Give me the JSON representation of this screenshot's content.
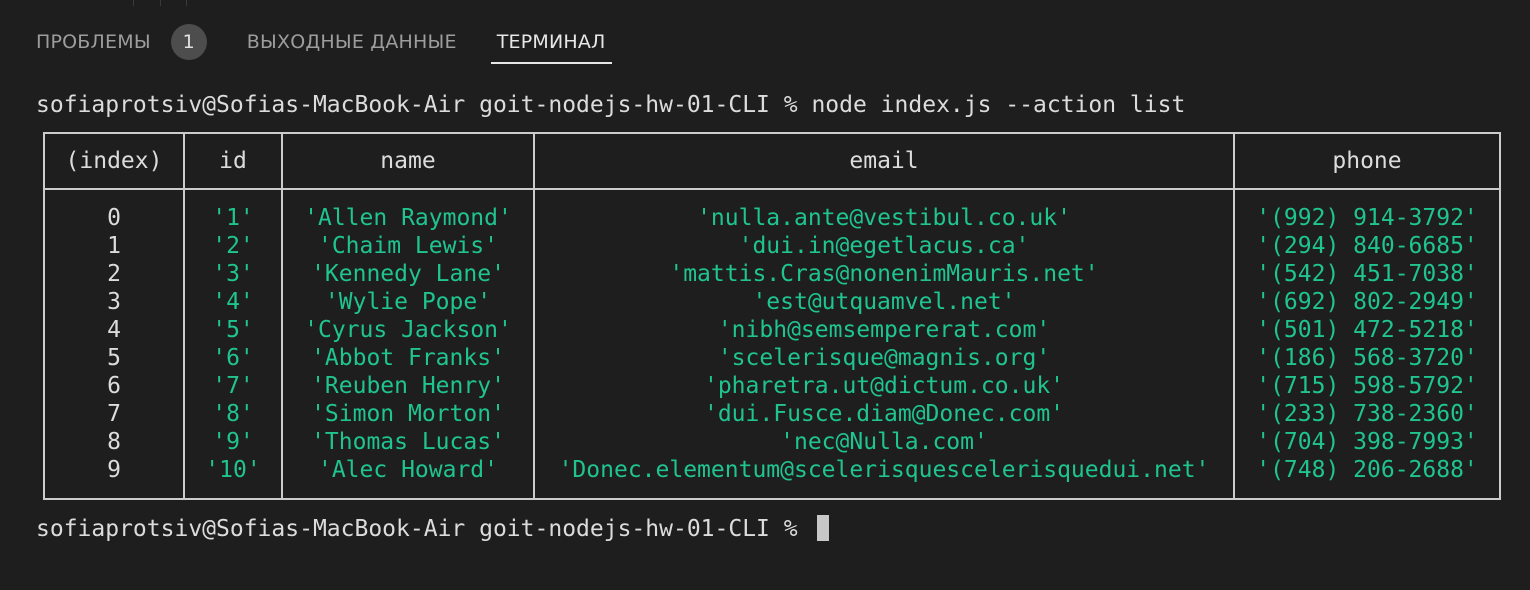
{
  "panel": {
    "tabs": [
      {
        "label": "ПРОБЛЕМЫ",
        "badge": "1"
      },
      {
        "label": "ВЫХОДНЫЕ ДАННЫЕ"
      },
      {
        "label": "ТЕРМИНАЛ",
        "active": true
      }
    ]
  },
  "terminal": {
    "command_line": "sofiaprotsiv@Sofias-MacBook-Air goit-nodejs-hw-01-CLI % node index.js --action list",
    "prompt_line": "sofiaprotsiv@Sofias-MacBook-Air goit-nodejs-hw-01-CLI % ",
    "table": {
      "headers": [
        "(index)",
        "id",
        "name",
        "email",
        "phone"
      ],
      "rows": [
        {
          "index": "0",
          "id": "'1'",
          "name": "'Allen Raymond'",
          "email": "'nulla.ante@vestibul.co.uk'",
          "phone": "'(992) 914-3792'"
        },
        {
          "index": "1",
          "id": "'2'",
          "name": "'Chaim Lewis'",
          "email": "'dui.in@egetlacus.ca'",
          "phone": "'(294) 840-6685'"
        },
        {
          "index": "2",
          "id": "'3'",
          "name": "'Kennedy Lane'",
          "email": "'mattis.Cras@nonenimMauris.net'",
          "phone": "'(542) 451-7038'"
        },
        {
          "index": "3",
          "id": "'4'",
          "name": "'Wylie Pope'",
          "email": "'est@utquamvel.net'",
          "phone": "'(692) 802-2949'"
        },
        {
          "index": "4",
          "id": "'5'",
          "name": "'Cyrus Jackson'",
          "email": "'nibh@semsempererat.com'",
          "phone": "'(501) 472-5218'"
        },
        {
          "index": "5",
          "id": "'6'",
          "name": "'Abbot Franks'",
          "email": "'scelerisque@magnis.org'",
          "phone": "'(186) 568-3720'"
        },
        {
          "index": "6",
          "id": "'7'",
          "name": "'Reuben Henry'",
          "email": "'pharetra.ut@dictum.co.uk'",
          "phone": "'(715) 598-5792'"
        },
        {
          "index": "7",
          "id": "'8'",
          "name": "'Simon Morton'",
          "email": "'dui.Fusce.diam@Donec.com'",
          "phone": "'(233) 738-2360'"
        },
        {
          "index": "8",
          "id": "'9'",
          "name": "'Thomas Lucas'",
          "email": "'nec@Nulla.com'",
          "phone": "'(704) 398-7993'"
        },
        {
          "index": "9",
          "id": "'10'",
          "name": "'Alec Howard'",
          "email": "'Donec.elementum@scelerisquescelerisquedui.net'",
          "phone": "'(748) 206-2688'"
        }
      ]
    }
  },
  "colors": {
    "background": "#1e1e1e",
    "text": "#dcdcdc",
    "string_value": "#1fc48f",
    "tab_inactive": "#9d9d9d",
    "tab_active": "#e7e7e7",
    "badge_bg": "#4d4d4d"
  }
}
